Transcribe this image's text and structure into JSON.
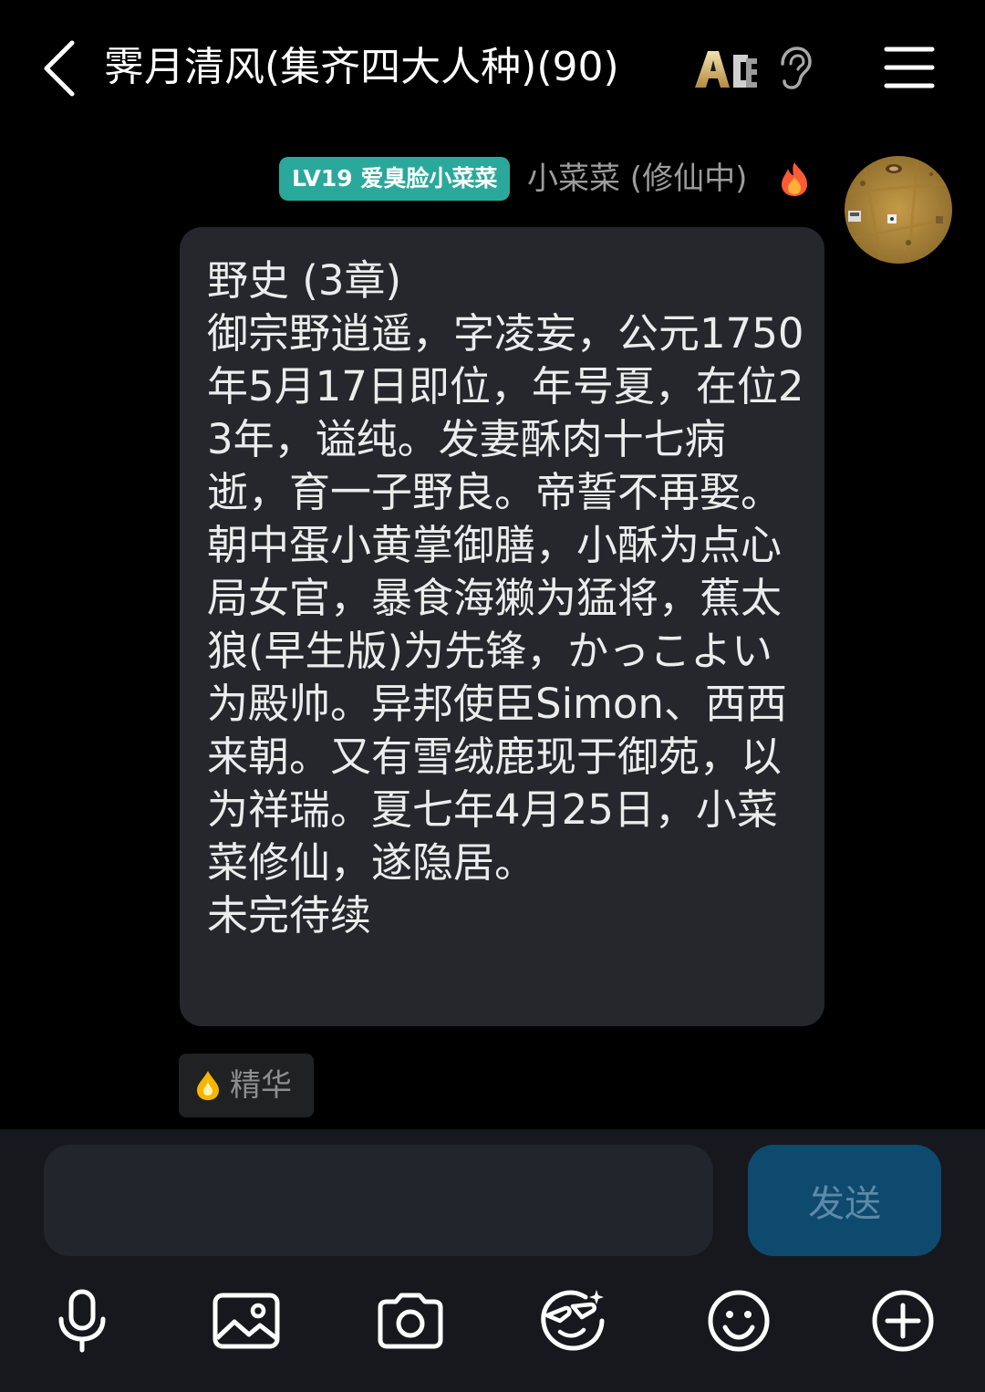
{
  "header": {
    "title": "霁月清风(集齐四大人种)(90)",
    "badge_text": "ACE"
  },
  "message": {
    "level_badge": "LV19 爱臭脸小菜菜",
    "sender": "小菜菜 (修仙中)",
    "body": "野史 (3章)\n御宗野逍遥，字凌妄，公元1750年5月17日即位，年号夏，在位23年，谥纯。发妻酥肉十七病逝，育一子野良。帝誓不再娶。朝中蛋小黄掌御膳，小酥为点心局女官，暴食海獭为猛将，蕉太狼(早生版)为先锋，かっこよい为殿帅。异邦使臣Simon、西西来朝。又有雪绒鹿现于御苑，以为祥瑞。夏七年4月25日，小菜菜修仙，遂隐居。\n未完待续",
    "essence_label": "精华"
  },
  "input": {
    "value": "",
    "send_label": "发送"
  },
  "toolbar": {
    "icons": [
      "microphone-icon",
      "image-icon",
      "camera-icon",
      "sticker-icon",
      "emoji-icon",
      "plus-icon"
    ]
  },
  "colors": {
    "level_badge_bg": "#2aa89b",
    "bubble_bg": "#25272c",
    "send_button_bg": "#0e4a6e"
  }
}
